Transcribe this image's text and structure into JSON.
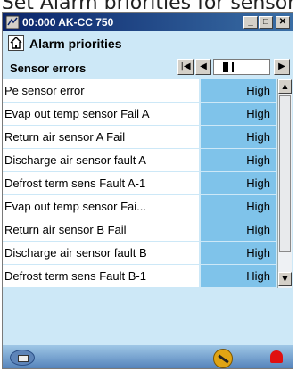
{
  "caption": "Set Alarm priorities for sensor",
  "window": {
    "title": "00:000 AK-CC 750",
    "buttons": {
      "minimize": "_",
      "maximize": "□",
      "close": "✕"
    }
  },
  "page": {
    "title": "Alarm priorities"
  },
  "section": {
    "title": "Sensor errors",
    "nav": {
      "first": "|◀",
      "prev": "◀",
      "next": "▶"
    }
  },
  "rows": [
    {
      "label": "Pe sensor error",
      "value": "High"
    },
    {
      "label": "Evap out temp sensor Fail A",
      "value": "High"
    },
    {
      "label": "Return air sensor A Fail",
      "value": "High"
    },
    {
      "label": "Discharge air sensor fault A",
      "value": "High"
    },
    {
      "label": "Defrost term sens Fault A-1",
      "value": "High"
    },
    {
      "label": "Evap out temp sensor Fai...",
      "value": "High"
    },
    {
      "label": "Return air sensor B Fail",
      "value": "High"
    },
    {
      "label": "Discharge air sensor fault B",
      "value": "High"
    },
    {
      "label": "Defrost term sens Fault B-1",
      "value": "High"
    }
  ],
  "icons": {
    "app": "app-icon",
    "home": "home-icon",
    "bottom_left": "controller-icon",
    "tool": "wrench-icon",
    "alarm": "bell-icon"
  }
}
